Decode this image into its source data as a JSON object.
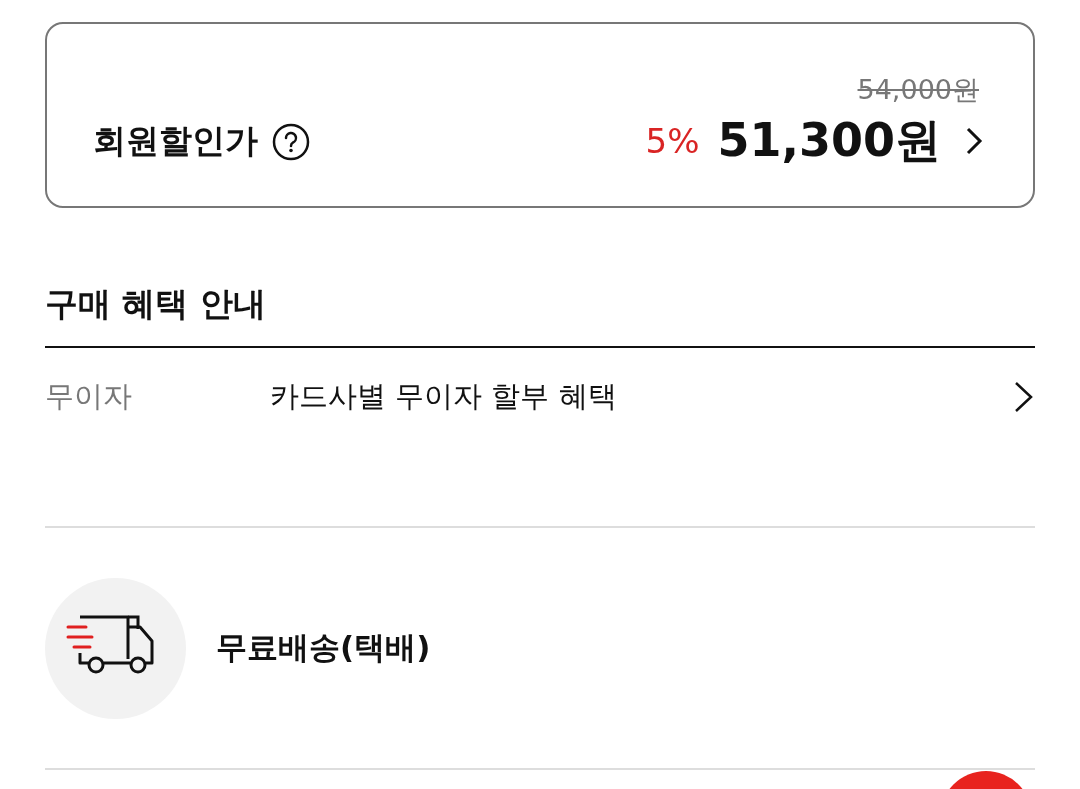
{
  "price_card": {
    "label": "회원할인가",
    "original_price": "54,000원",
    "discount_rate": "5%",
    "price": "51,300원"
  },
  "benefits": {
    "title": "구매 혜택 안내",
    "rows": [
      {
        "label": "무이자",
        "text": "카드사별 무이자 할부 혜택"
      }
    ]
  },
  "shipping": {
    "text": "무료배송(택배)"
  }
}
